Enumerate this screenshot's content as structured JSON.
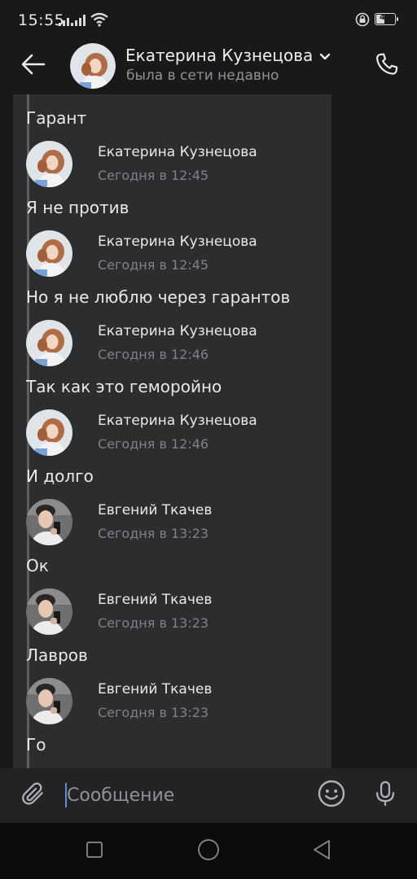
{
  "status_bar": {
    "time": "15:55",
    "battery": "46",
    "battery_level": 0.46,
    "icons": [
      "signal-icon",
      "wifi-icon",
      "lock-icon",
      "battery-icon"
    ]
  },
  "header": {
    "contact_name": "Екатерина Кузнецова",
    "contact_status": "была в сети недавно",
    "icons": [
      "back-arrow-icon",
      "chevron-down-icon",
      "phone-icon"
    ]
  },
  "messages": [
    {
      "type": "text",
      "text": "Гарант"
    },
    {
      "type": "author",
      "author": "Екатерина Кузнецова",
      "time": "Сегодня в 12:45",
      "avatar": "female"
    },
    {
      "type": "text",
      "text": "Я не против"
    },
    {
      "type": "author",
      "author": "Екатерина Кузнецова",
      "time": "Сегодня в 12:45",
      "avatar": "female"
    },
    {
      "type": "text",
      "text": "Но я не люблю через гарантов"
    },
    {
      "type": "author",
      "author": "Екатерина Кузнецова",
      "time": "Сегодня в 12:46",
      "avatar": "female"
    },
    {
      "type": "text",
      "text": "Так как это геморойно"
    },
    {
      "type": "author",
      "author": "Екатерина Кузнецова",
      "time": "Сегодня в 12:46",
      "avatar": "female"
    },
    {
      "type": "text",
      "text": "И долго"
    },
    {
      "type": "author",
      "author": "Евгений Ткачев",
      "time": "Сегодня в 13:23",
      "avatar": "male"
    },
    {
      "type": "text",
      "text": "Ок"
    },
    {
      "type": "author",
      "author": "Евгений Ткачев",
      "time": "Сегодня в 13:23",
      "avatar": "male"
    },
    {
      "type": "text",
      "text": "Лавров"
    },
    {
      "type": "author",
      "author": "Евгений Ткачев",
      "time": "Сегодня в 13:23",
      "avatar": "male"
    },
    {
      "type": "text",
      "text": "Го"
    }
  ],
  "composer": {
    "placeholder": "Сообщение",
    "value": "",
    "icons": [
      "paperclip-icon",
      "emoji-icon",
      "microphone-icon"
    ]
  },
  "nav_bar": {
    "icons": [
      "recents-square-icon",
      "home-circle-icon",
      "back-triangle-icon"
    ]
  },
  "colors": {
    "background": "#19191a",
    "forward_panel": "#2c2d2f",
    "quote_bar": "#5c5e62",
    "text_primary": "#e8e9eb",
    "text_secondary": "#7e8186",
    "accent_caret": "#5b8fd9"
  }
}
